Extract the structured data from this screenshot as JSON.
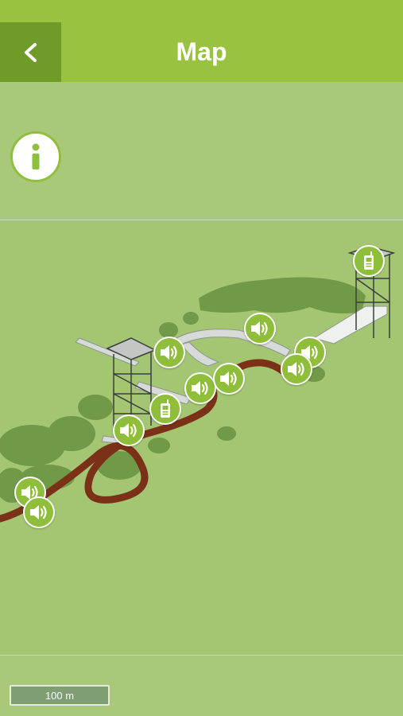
{
  "header": {
    "title": "Map",
    "back_icon": "chevron-left-icon",
    "color": "#98c23f",
    "back_color": "#6f9b28"
  },
  "map": {
    "info_icon": "info-icon",
    "scale_label": "100 m",
    "trail_color": "#7a3118",
    "marker_color": "#8fbe3a",
    "markers": [
      {
        "icon": "speaker-icon"
      },
      {
        "icon": "speaker-icon"
      },
      {
        "icon": "speaker-icon"
      },
      {
        "icon": "speaker-icon"
      },
      {
        "icon": "speaker-icon"
      },
      {
        "icon": "speaker-icon"
      },
      {
        "icon": "speaker-icon"
      },
      {
        "icon": "speaker-icon"
      },
      {
        "icon": "speaker-icon"
      },
      {
        "icon": "walkie-talkie-icon"
      },
      {
        "icon": "walkie-talkie-icon"
      }
    ]
  }
}
